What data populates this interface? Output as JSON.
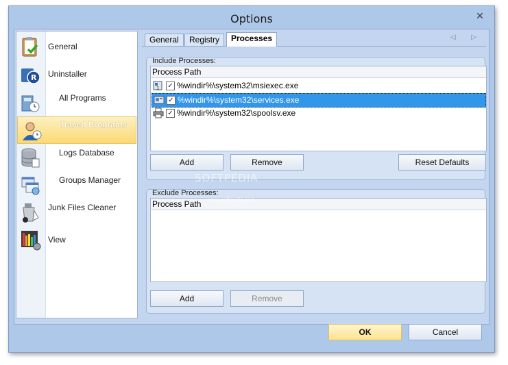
{
  "window": {
    "title": "Options",
    "close_glyph": "✕"
  },
  "sidebar": {
    "items": [
      {
        "label": "General",
        "icon": "clipboard-check-icon"
      },
      {
        "label": "Uninstaller",
        "icon": "uninstaller-icon"
      },
      {
        "label": "All Programs",
        "icon": "all-programs-icon"
      },
      {
        "label": "Traced Programs",
        "icon": "traced-programs-icon"
      },
      {
        "label": "Logs Database",
        "icon": "database-icon"
      },
      {
        "label": "Groups Manager",
        "icon": "groups-manager-icon"
      },
      {
        "label": "Junk Files Cleaner",
        "icon": "junk-cleaner-icon"
      },
      {
        "label": "View",
        "icon": "view-icon"
      }
    ],
    "selected": "Traced Programs"
  },
  "tabs": {
    "items": [
      "General",
      "Registry",
      "Processes"
    ],
    "active": "Processes",
    "arrows": "◁ ▷"
  },
  "include": {
    "caption": "Include Processes:",
    "column": "Process Path",
    "rows": [
      {
        "path": "%windir%\\system32\\msiexec.exe",
        "checked": true,
        "icon": "installer-icon"
      },
      {
        "path": "%windir%\\system32\\services.exe",
        "checked": true,
        "icon": "services-icon"
      },
      {
        "path": "%windir%\\system32\\spoolsv.exe",
        "checked": true,
        "icon": "printer-icon"
      }
    ],
    "selected_row": 1,
    "buttons": {
      "add": "Add",
      "remove": "Remove",
      "reset": "Reset Defaults"
    }
  },
  "exclude": {
    "caption": "Exclude Processes:",
    "column": "Process Path",
    "buttons": {
      "add": "Add",
      "remove": "Remove"
    }
  },
  "footer": {
    "ok": "OK",
    "cancel": "Cancel"
  },
  "watermark": {
    "text": "SOFTPEDIA",
    "sub": "www.softpedia.com"
  },
  "check_glyph": "✓"
}
